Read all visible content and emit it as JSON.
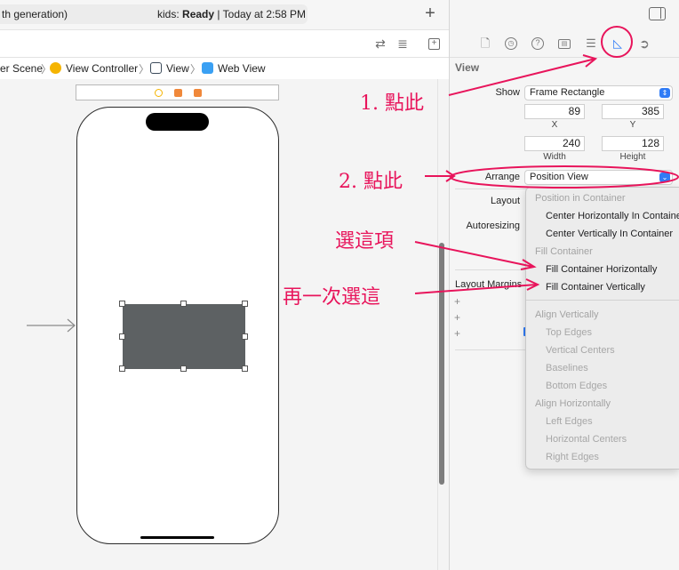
{
  "topbar": {
    "scheme_text": "th generation)",
    "status_app": "kids:",
    "status_state": "Ready",
    "status_time": "| Today at 2:58 PM"
  },
  "breadcrumb": {
    "items": [
      "er Scene",
      "View Controller",
      "View",
      "Web View"
    ]
  },
  "inspector": {
    "section_title": "View",
    "show_label": "Show",
    "show_value": "Frame Rectangle",
    "x_value": "89",
    "y_value": "385",
    "x_label": "X",
    "y_label": "Y",
    "width_value": "240",
    "height_value": "128",
    "width_label": "Width",
    "height_label": "Height",
    "arrange_label": "Arrange",
    "arrange_value": "Position View",
    "layout_label": "Layout",
    "autoresizing_label": "Autoresizing",
    "layout_margins_label": "Layout Margins",
    "plus_signs": [
      "+",
      "+",
      "+"
    ]
  },
  "menu": {
    "items": [
      {
        "text": "Position in Container",
        "kind": "header"
      },
      {
        "text": "Center Horizontally In Container",
        "kind": "item"
      },
      {
        "text": "Center Vertically In Container",
        "kind": "item"
      },
      {
        "text": "Fill Container",
        "kind": "header"
      },
      {
        "text": "Fill Container Horizontally",
        "kind": "item"
      },
      {
        "text": "Fill Container Vertically",
        "kind": "item"
      },
      {
        "text": "Align Vertically",
        "kind": "header"
      },
      {
        "text": "Top Edges",
        "kind": "disabled"
      },
      {
        "text": "Vertical Centers",
        "kind": "disabled"
      },
      {
        "text": "Baselines",
        "kind": "disabled"
      },
      {
        "text": "Bottom Edges",
        "kind": "disabled"
      },
      {
        "text": "Align Horizontally",
        "kind": "header"
      },
      {
        "text": "Left Edges",
        "kind": "disabled"
      },
      {
        "text": "Horizontal Centers",
        "kind": "disabled"
      },
      {
        "text": "Right Edges",
        "kind": "disabled"
      }
    ]
  },
  "annotations": {
    "step1": "1. 點此",
    "step2": "2. 點此",
    "step3": "選這項",
    "step4": "再一次選這"
  },
  "colors": {
    "annotation": "#e8145b",
    "accent": "#2f7bf6",
    "web_view_fill": "#5d6163"
  },
  "icons": {
    "inspector_tabs": [
      "file-icon",
      "history-icon",
      "help-icon",
      "identity-icon",
      "attributes-icon",
      "size-ruler-icon",
      "connections-icon"
    ]
  }
}
